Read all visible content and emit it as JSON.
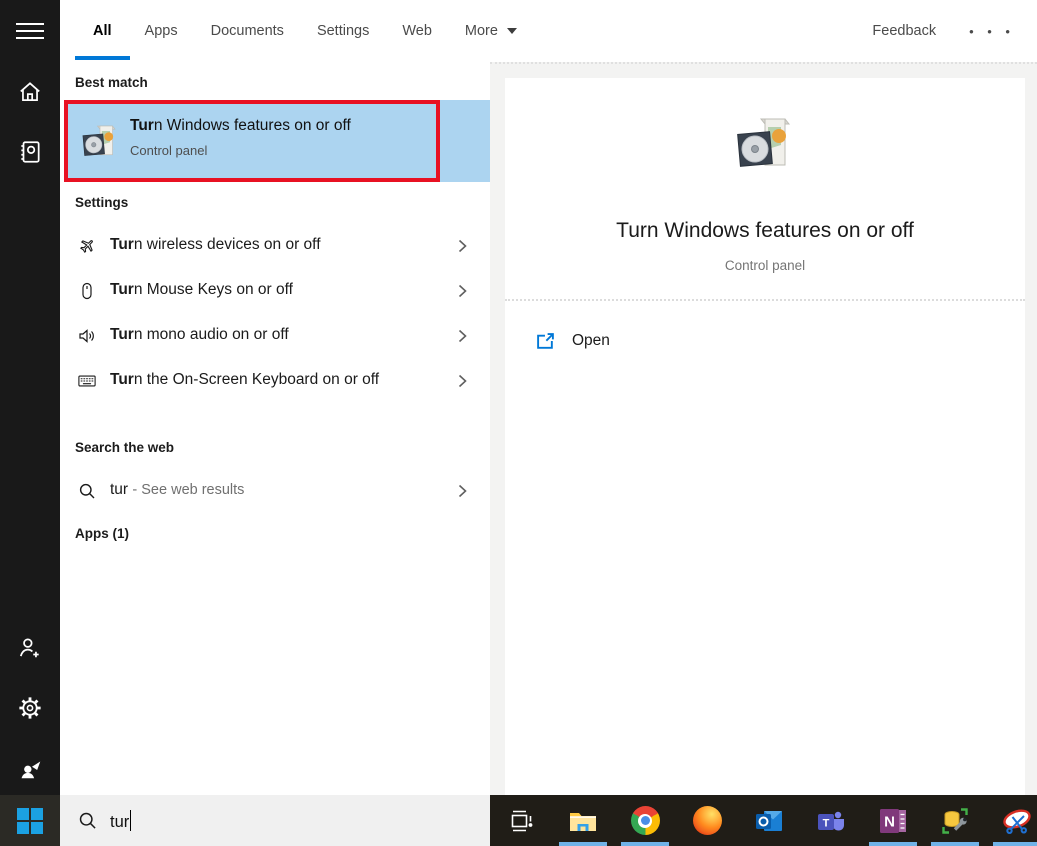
{
  "colors": {
    "accent": "#0078d7",
    "highlight_blue": "#acd4f0",
    "annotation_red": "#e81123",
    "rail_bg": "#191919",
    "taskbar_bg": "#201d17"
  },
  "topbar": {
    "tabs": [
      {
        "label": "All",
        "active": true
      },
      {
        "label": "Apps",
        "active": false
      },
      {
        "label": "Documents",
        "active": false
      },
      {
        "label": "Settings",
        "active": false
      },
      {
        "label": "Web",
        "active": false
      }
    ],
    "more_label": "More",
    "feedback_label": "Feedback",
    "ellipsis": "• • •"
  },
  "left_rail": {
    "icons": [
      "hamburger-menu",
      "home",
      "journal",
      "add-person",
      "settings-gear",
      "feedback-person"
    ]
  },
  "panel": {
    "best_match_header": "Best match",
    "best_match": {
      "title_bold": "Tur",
      "title_rest": "n Windows features on or off",
      "subtitle": "Control panel",
      "icon": "windows-features"
    },
    "settings_header": "Settings",
    "settings_items": [
      {
        "icon": "airplane",
        "bold": "Tur",
        "rest": "n wireless devices on or off"
      },
      {
        "icon": "mouse",
        "bold": "Tur",
        "rest": "n Mouse Keys on or off"
      },
      {
        "icon": "speaker",
        "bold": "Tur",
        "rest": "n mono audio on or off"
      },
      {
        "icon": "keyboard",
        "bold": "Tur",
        "rest": "n the On-Screen Keyboard on or off"
      }
    ],
    "web_header": "Search the web",
    "web_item": {
      "icon": "search",
      "query": "tur",
      "suffix": "- See web results"
    },
    "apps_header": "Apps (1)"
  },
  "preview": {
    "icon": "windows-features",
    "title": "Turn Windows features on or off",
    "subtitle": "Control panel",
    "actions": [
      {
        "icon": "open-external",
        "label": "Open"
      }
    ]
  },
  "search": {
    "value": "tur"
  },
  "taskbar": {
    "apps": [
      "task-view",
      "file-explorer",
      "chrome",
      "firefox",
      "outlook",
      "teams",
      "onenote",
      "database-tool",
      "snipping-tool"
    ],
    "running": [
      "file-explorer",
      "chrome",
      "onenote",
      "database-tool",
      "snipping-tool"
    ]
  }
}
